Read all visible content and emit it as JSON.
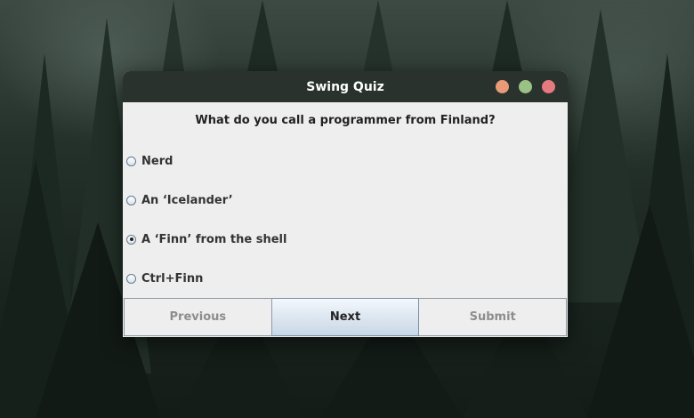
{
  "window": {
    "title": "Swing Quiz",
    "controls": [
      "minimize-icon",
      "maximize-icon",
      "close-icon"
    ]
  },
  "quiz": {
    "question": "What do you call a programmer from Finland?",
    "options": [
      {
        "label": "Nerd",
        "selected": false
      },
      {
        "label": "An ‘Icelander’",
        "selected": false
      },
      {
        "label": "A ‘Finn’ from the shell",
        "selected": true
      },
      {
        "label": "Ctrl+Finn",
        "selected": false
      }
    ]
  },
  "buttons": {
    "previous": "Previous",
    "next": "Next",
    "submit": "Submit"
  },
  "colors": {
    "titlebar": "#2a322d",
    "window_bg": "#eeeeee",
    "minimize": "#e99a76",
    "maximize": "#99c284",
    "close": "#e57a80"
  }
}
